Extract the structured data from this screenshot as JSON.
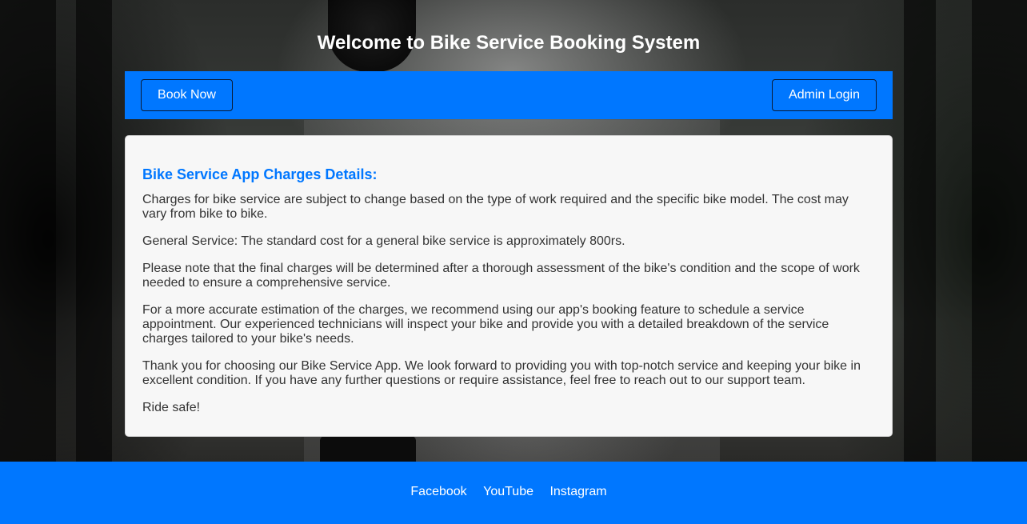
{
  "header": {
    "title": "Welcome to Bike Service Booking System"
  },
  "nav": {
    "book_label": "Book Now",
    "admin_label": "Admin Login"
  },
  "content": {
    "heading": "Bike Service App Charges Details:",
    "paragraphs": [
      "Charges for bike service are subject to change based on the type of work required and the specific bike model. The cost may vary from bike to bike.",
      "General Service: The standard cost for a general bike service is approximately 800rs.",
      "Please note that the final charges will be determined after a thorough assessment of the bike's condition and the scope of work needed to ensure a comprehensive service.",
      "For a more accurate estimation of the charges, we recommend using our app's booking feature to schedule a service appointment. Our experienced technicians will inspect your bike and provide you with a detailed breakdown of the service charges tailored to your bike's needs.",
      "Thank you for choosing our Bike Service App. We look forward to providing you with top-notch service and keeping your bike in excellent condition. If you have any further questions or require assistance, feel free to reach out to our support team.",
      "Ride safe!"
    ]
  },
  "footer": {
    "links": [
      "Facebook",
      "YouTube",
      "Instagram"
    ]
  },
  "colors": {
    "accent": "#0077ff",
    "card_background": "#f7f7f7",
    "text": "#333333"
  }
}
